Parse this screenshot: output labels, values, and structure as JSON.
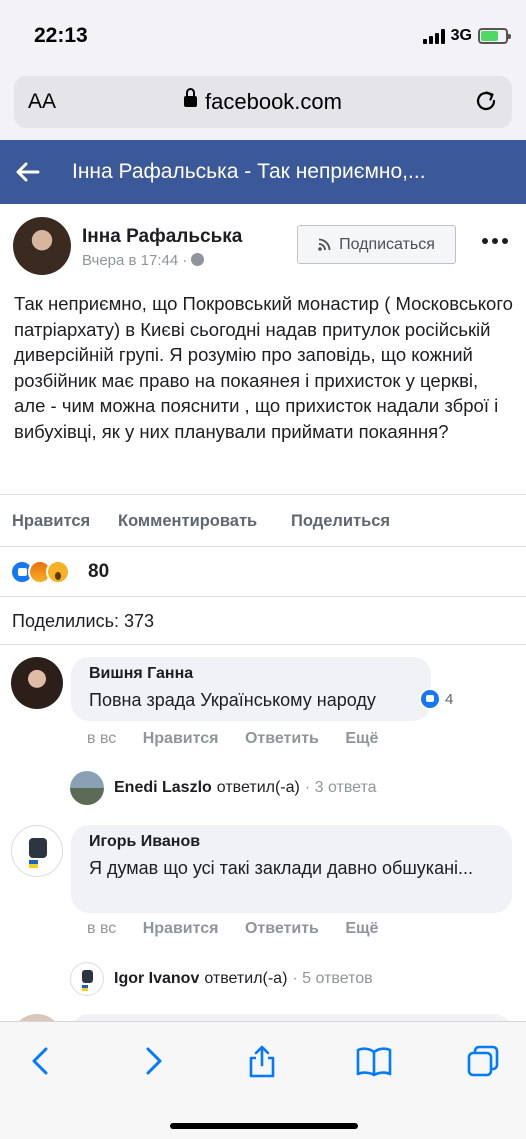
{
  "status_bar": {
    "time": "22:13",
    "network": "3G"
  },
  "browser": {
    "aa_label": "AA",
    "url": "facebook.com"
  },
  "header": {
    "title": "Інна Рафальська - Так неприємно,..."
  },
  "post": {
    "author": "Інна Рафальська",
    "timestamp": "Вчера в 17:44 ·",
    "subscribe_label": "Подписаться",
    "text": "Так неприємно, що Покровський монастир ( Московського патріархату) в Києві сьогодні надав притулок російській диверсійній групі. Я розумію про заповідь, що кожний розбійник має право на покаянея і прихисток у церкві, але - чим можна пояснити , що прихисток надали зброї і вибухівці, як у них планували приймати покаяння?",
    "actions": {
      "like": "Нравится",
      "comment": "Комментировать",
      "share": "Поделиться"
    },
    "reaction_count": "80",
    "shares": "Поделились: 373"
  },
  "comments": [
    {
      "author": "Вишня Ганна",
      "text": "Повна зрада Українському народу",
      "likes": "4",
      "time": "в вс",
      "like_label": "Нравится",
      "reply_label": "Ответить",
      "more_label": "Ещё",
      "reply_summary": {
        "author": "Enedi Laszlo",
        "verb": "ответил(-а)",
        "count": "· 3 ответа"
      }
    },
    {
      "author": "Игорь Иванов",
      "text": "Я думав що усі такі заклади давно обшукані...",
      "time": "в вс",
      "like_label": "Нравится",
      "reply_label": "Ответить",
      "more_label": "Ещё",
      "reply_summary": {
        "author": "Igor Ivanov",
        "verb": "ответил(-а)",
        "count": "· 5 ответов"
      }
    }
  ],
  "colors": {
    "fb_blue": "#3b5998",
    "like_blue": "#1877f2",
    "ios_blue": "#007aff"
  },
  "toolbar_icons": [
    "back-icon",
    "forward-icon",
    "share-icon",
    "bookmarks-icon",
    "tabs-icon"
  ]
}
